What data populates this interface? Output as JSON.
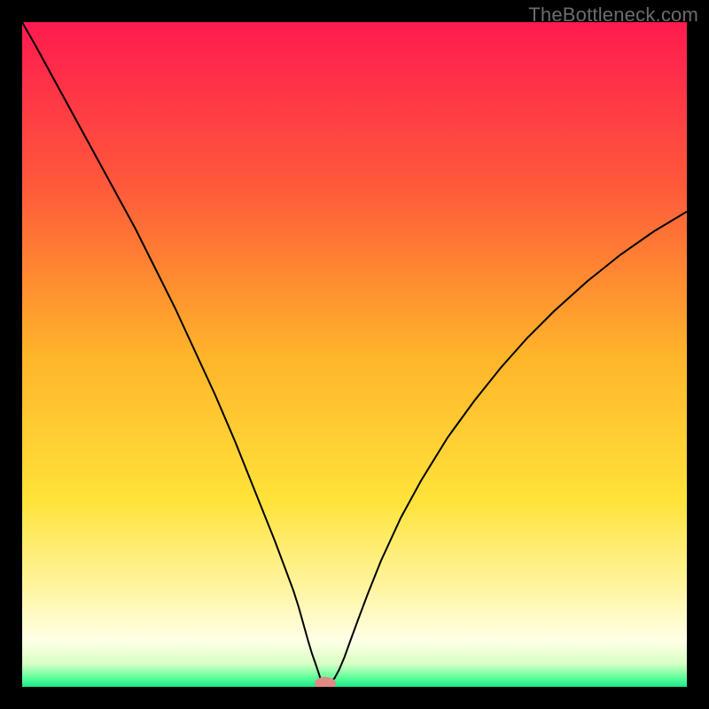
{
  "watermark": "TheBottleneck.com",
  "chart_data": {
    "type": "line",
    "title": "",
    "xlabel": "",
    "ylabel": "",
    "xlim": [
      0,
      100
    ],
    "ylim": [
      0,
      100
    ],
    "grid": false,
    "background_gradient": {
      "orientation": "vertical",
      "stops": [
        {
          "t": 0.0,
          "color": "#ff1a4f"
        },
        {
          "t": 0.25,
          "color": "#ff5a3a"
        },
        {
          "t": 0.5,
          "color": "#ffb42a"
        },
        {
          "t": 0.72,
          "color": "#ffe33a"
        },
        {
          "t": 0.86,
          "color": "#fff6a8"
        },
        {
          "t": 0.93,
          "color": "#ffffe6"
        },
        {
          "t": 0.965,
          "color": "#d9ffc4"
        },
        {
          "t": 0.985,
          "color": "#66ff9e"
        },
        {
          "t": 1.0,
          "color": "#18e987"
        }
      ]
    },
    "series": [
      {
        "name": "curve",
        "color": "#000000",
        "stroke_width": 2,
        "x": [
          0,
          2,
          5,
          8,
          11,
          14,
          17,
          20,
          23,
          26,
          29,
          32,
          34,
          36,
          38,
          39.5,
          40.8,
          41.6,
          42.3,
          43.0,
          43.6,
          44.2,
          44.7,
          45.0,
          46.3,
          47.0,
          47.7,
          48.5,
          49.4,
          50.5,
          52,
          54,
          57,
          60,
          64,
          68,
          72,
          76,
          80,
          85,
          90,
          95,
          100
        ],
        "y": [
          100,
          96.5,
          91,
          85.5,
          80,
          74.5,
          69,
          63,
          57,
          50.5,
          44,
          37,
          32,
          27,
          22,
          18,
          14.5,
          12,
          9.5,
          7,
          5,
          3.3,
          1.8,
          0.8,
          0.6,
          1.3,
          2.6,
          4.5,
          7,
          10,
          14,
          19,
          25.5,
          31,
          37.5,
          43,
          48,
          52.5,
          56.5,
          61,
          65,
          68.5,
          71.5
        ]
      }
    ],
    "marker": {
      "name": "min-point",
      "x": 45.6,
      "y": 0.5,
      "color": "#e08a86",
      "rx": 1.6,
      "ry": 1.0
    }
  }
}
